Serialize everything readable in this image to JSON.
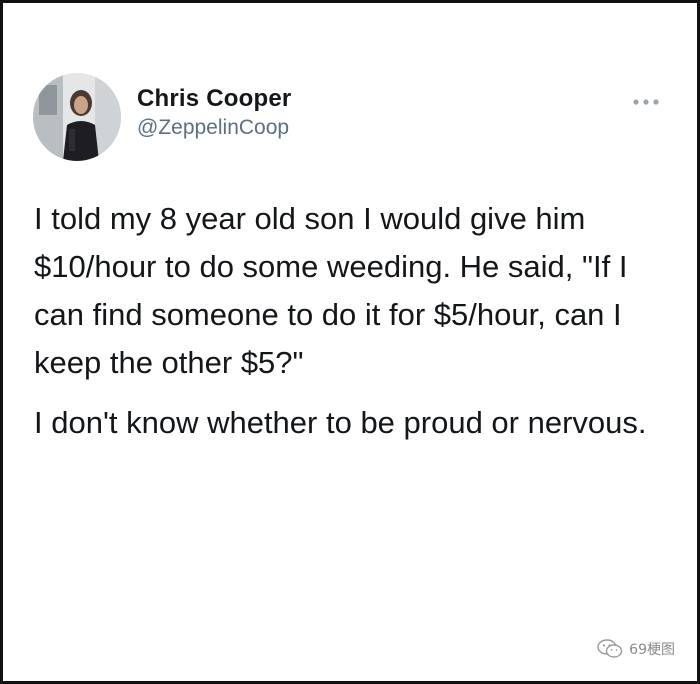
{
  "author": {
    "display_name": "Chris Cooper",
    "handle": "@ZeppelinCoop",
    "avatar_icon": "profile-photo-icon"
  },
  "tweet": {
    "paragraphs": [
      "I told my 8 year old son I would give him $10/hour to do some weeding. He said, \"If I can find someone to do it for $5/hour, can I keep the other $5?\"",
      "I don't know whether to be proud or nervous."
    ]
  },
  "menu": {
    "icon": "more-options-icon"
  },
  "watermark": {
    "text": "69梗图",
    "icon": "wechat-logo-icon"
  },
  "colors": {
    "text_primary": "#14171a",
    "text_secondary": "#5b7083",
    "border": "#111111"
  }
}
